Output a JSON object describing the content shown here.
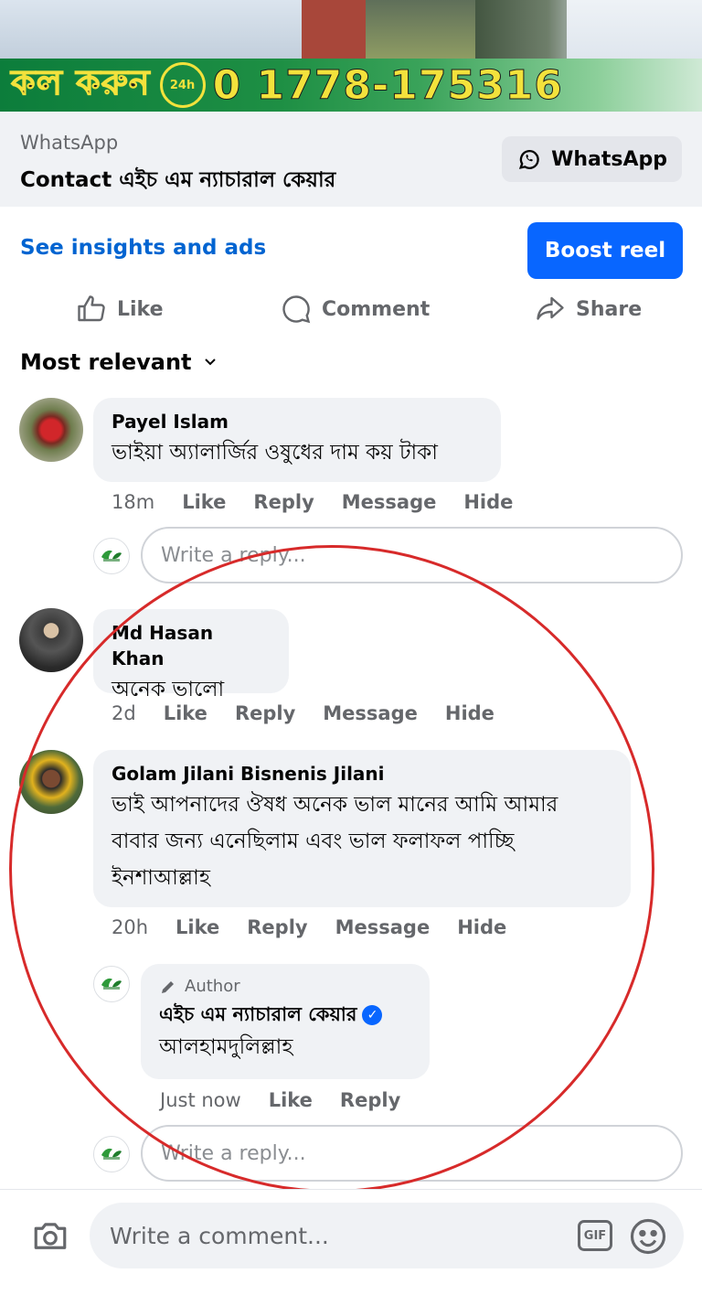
{
  "banner": {
    "call_text": "কল করুন",
    "badge": "24h",
    "phone": "0 1778-175316"
  },
  "whatsapp_cta": {
    "subtitle": "WhatsApp",
    "title": "Contact এইচ এম ন্যাচারাল কেয়ার",
    "button_label": "WhatsApp"
  },
  "insights_link": "See insights and ads",
  "boost_button": "Boost reel",
  "actions": {
    "like": "Like",
    "comment": "Comment",
    "share": "Share"
  },
  "sort_label": "Most relevant",
  "comments": [
    {
      "name": "Payel Islam",
      "text": "ভাইয়া অ্যালার্জির ওষুধের দাম কয় টাকা",
      "time": "18m",
      "like": "Like",
      "reply": "Reply",
      "message": "Message",
      "hide": "Hide"
    },
    {
      "name": "Md Hasan Khan",
      "text": "অনেক ভালো",
      "time": "2d",
      "like": "Like",
      "reply": "Reply",
      "message": "Message",
      "hide": "Hide"
    },
    {
      "name": "Golam Jilani Bisnenis Jilani",
      "text_line1": "ভাই আপনাদের ঔষধ অনেক ভাল মানের আমি আমার",
      "text_line2": "বাবার জন্য এনেছিলাম এবং ভাল ফলাফল পাচ্ছি",
      "text_line3": "ইনশাআল্লাহ",
      "time": "20h",
      "like": "Like",
      "reply": "Reply",
      "message": "Message",
      "hide": "Hide"
    }
  ],
  "author_reply": {
    "tag": "Author",
    "name": "এইচ এম ন্যাচারাল কেয়ার",
    "text": "আলহামদুলিল্লাহ",
    "time": "Just now",
    "like": "Like",
    "reply": "Reply"
  },
  "reply_placeholder": "Write a reply...",
  "comment_placeholder": "Write a comment...",
  "gif_label": "GIF",
  "colors": {
    "accent": "#0866ff",
    "link": "#0064d1",
    "annotation": "#d72a2a",
    "bubble": "#f0f2f5"
  }
}
